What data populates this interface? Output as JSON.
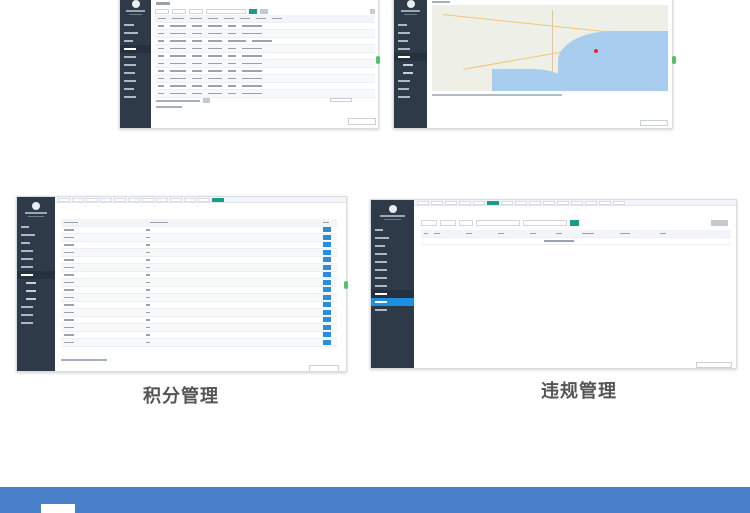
{
  "captions": {
    "points": "积分管理",
    "violations": "违规管理"
  },
  "colors": {
    "sidebar": "#2e3a48",
    "accent": "#1f8fe0",
    "footer_band": "#4a7fca",
    "caption": "#555555"
  },
  "screens": [
    {
      "name": "list-screen-top-left"
    },
    {
      "name": "map-screen-top-right"
    },
    {
      "name": "points-screen"
    },
    {
      "name": "violations-screen"
    }
  ]
}
